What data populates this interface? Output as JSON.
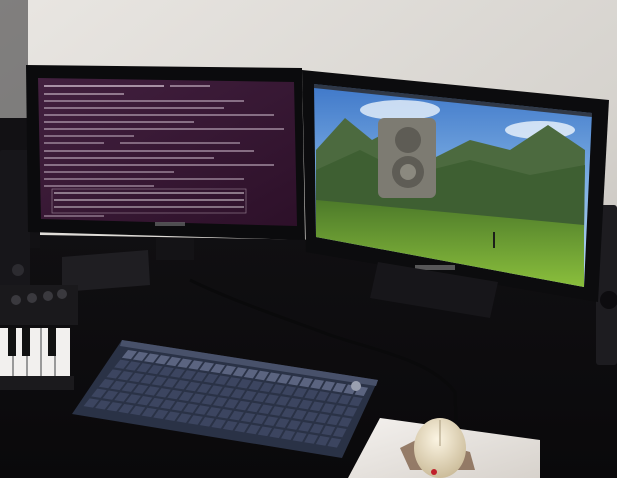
{
  "scene": {
    "left_monitor": {
      "brand": "",
      "terminal": {
        "lines": [
          "",
          "",
          "",
          "",
          "",
          "",
          "",
          "",
          "",
          "",
          "",
          "",
          "",
          "",
          "",
          "",
          "",
          "",
          "",
          "",
          "",
          "",
          "",
          ""
        ]
      }
    },
    "right_monitor": {
      "brand": "",
      "wallpaper": "landscape-with-ruined-tower"
    },
    "colors": {
      "wall": "#d9d6d1",
      "desk": "#0e0d10",
      "terminal_bg": "#3a1838",
      "keyboard": "#2b3347",
      "mousepad": "#ece8e4",
      "mouse": "#e8dcc2"
    }
  }
}
